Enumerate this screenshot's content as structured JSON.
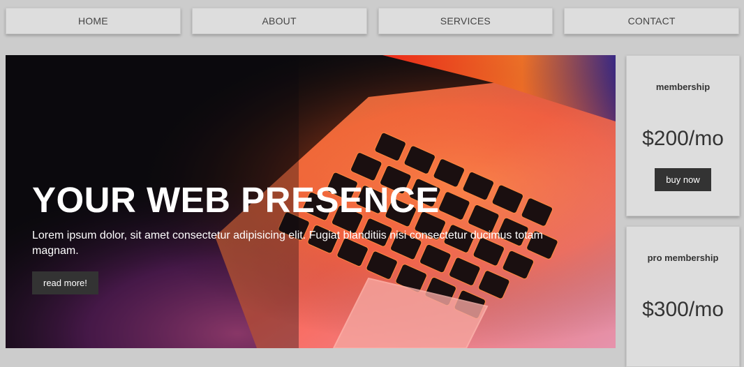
{
  "nav": {
    "items": [
      {
        "label": "HOME"
      },
      {
        "label": "ABOUT"
      },
      {
        "label": "SERVICES"
      },
      {
        "label": "CONTACT"
      }
    ]
  },
  "hero": {
    "title": "YOUR WEB PRESENCE",
    "text": "Lorem ipsum dolor, sit amet consectetur adipisicing elit. Fugiat blanditiis nisi consectetur ducimus totam magnam.",
    "button_label": "read more!",
    "image": "laptop-keyboard-photo"
  },
  "pricing": [
    {
      "title": "membership",
      "price": "$200/mo",
      "button_label": "buy now"
    },
    {
      "title": "pro membership",
      "price": "$300/mo"
    }
  ],
  "colors": {
    "background": "#cccccc",
    "card": "#dddddd",
    "button": "#333333",
    "button_text": "#ffffff"
  }
}
